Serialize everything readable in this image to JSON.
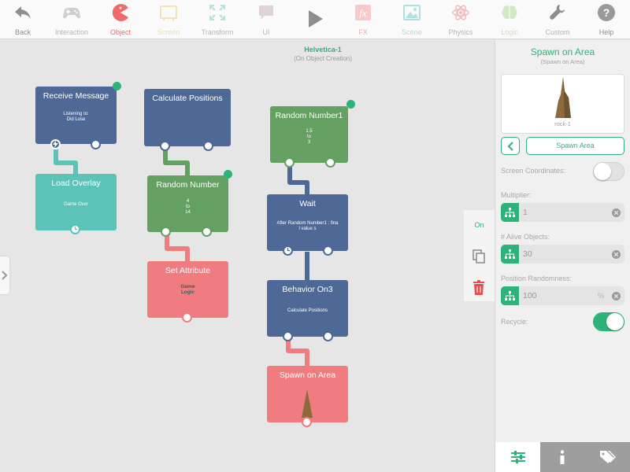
{
  "toolbar": {
    "back": "Back",
    "interaction": "Interaction",
    "object": "Object",
    "screen": "Screen",
    "transform": "Transform",
    "ui": "UI",
    "fx": "FX",
    "scene": "Scene",
    "physics": "Physics",
    "logic": "Logic",
    "custom": "Custom",
    "help": "Help"
  },
  "canvas": {
    "object_name": "Helvetica-1",
    "object_event": "(On Object Creation)",
    "nodes": {
      "receive_message": {
        "title": "Receive Message",
        "body": "Listening to:\nDid Lose"
      },
      "load_overlay": {
        "title": "Load Overlay",
        "body": "Game Over"
      },
      "calculate_positions": {
        "title": "Calculate Positions"
      },
      "random_number": {
        "title": "Random Number",
        "body": "4\nto\n14"
      },
      "set_attribute": {
        "title": "Set Attribute",
        "body": "Game\nLogic"
      },
      "random_number1": {
        "title": "Random Number1",
        "body": "1.5\nto\n3"
      },
      "wait": {
        "title": "Wait",
        "body": "After Random Number1 : fina\nl value s"
      },
      "behavior_on3": {
        "title": "Behavior On3",
        "body": "Calculate Positions"
      },
      "spawn_on_area": {
        "title": "Spawn on Area"
      }
    }
  },
  "side_actions": {
    "on_label": "On"
  },
  "panel": {
    "title": "Spawn on Area",
    "subtitle": "(Spawn on Area)",
    "preview_label": "rock-1",
    "area_button": "Spawn Area",
    "screen_coordinates": {
      "label": "Screen Coordinates:",
      "on": false
    },
    "multiplier": {
      "label": "Multiplier:",
      "value": "1"
    },
    "alive_objects": {
      "label": "# Alive Objects:",
      "value": "30"
    },
    "position_randomness": {
      "label": "Position Randomness:",
      "value": "100",
      "unit": "%"
    },
    "recycle": {
      "label": "Recycle:",
      "on": true
    }
  },
  "colors": {
    "accent": "#2db27a",
    "node_blue": "#4f6996",
    "node_green": "#65a063",
    "node_teal": "#5dc3b9",
    "node_pink": "#f07c7f",
    "active_tab": "#f06a6a"
  },
  "icons": {
    "back": "back-arrow-icon",
    "interaction": "gamepad-icon",
    "object": "pacman-icon",
    "screen": "screen-icon",
    "transform": "transform-arrows-icon",
    "ui": "speech-bubble-icon",
    "play": "play-icon",
    "fx": "fx-icon",
    "scene": "image-icon",
    "physics": "atom-icon",
    "logic": "brain-icon",
    "custom": "wrench-icon",
    "help": "question-icon"
  }
}
